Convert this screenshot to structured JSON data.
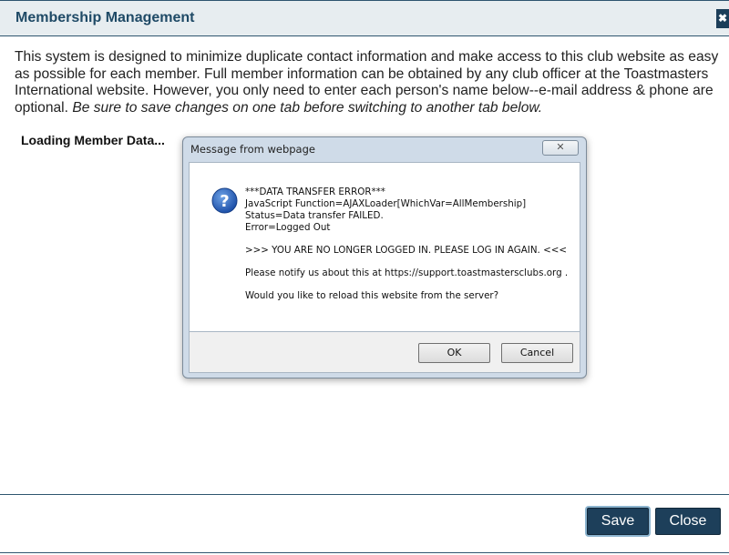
{
  "header": {
    "title": "Membership Management",
    "close_glyph": "✖"
  },
  "intro": {
    "text": "This system is designed to minimize duplicate contact information and make access to this club website as easy as possible for each member. Full member information can be obtained by any club officer at the Toastmasters International website. However, you only need to enter each person's name below--e-mail address & phone are optional.",
    "italic_text": "Be sure to save changes on one tab before switching to another tab below."
  },
  "loading_text": "Loading Member Data...",
  "dialog": {
    "title": "Message from webpage",
    "close_glyph": "✕",
    "icon": "question-icon",
    "lines": {
      "l1": "***DATA TRANSFER ERROR***",
      "l2": "JavaScript Function=AJAXLoader[WhichVar=AllMembership]",
      "l3": "Status=Data transfer FAILED.",
      "l4": "Error=Logged Out",
      "l5": ">>> YOU ARE NO LONGER LOGGED IN. PLEASE LOG IN AGAIN. <<<",
      "l6": "Please notify us about this at https://support.toastmastersclubs.org .",
      "l7": "Would you like to reload this website from the server?"
    },
    "ok_label": "OK",
    "cancel_label": "Cancel"
  },
  "footer": {
    "save_label": "Save",
    "close_label": "Close"
  },
  "colors": {
    "brand": "#1d3f5a",
    "header_bg": "#e7edf0",
    "title_text": "#1f4a66"
  }
}
